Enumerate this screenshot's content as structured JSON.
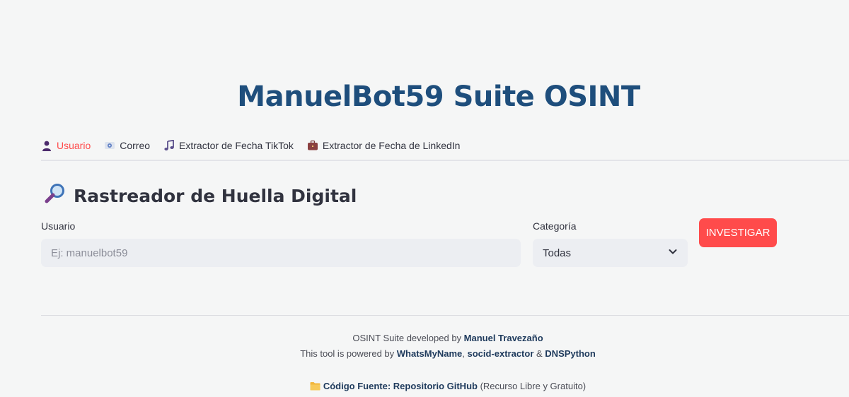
{
  "app": {
    "title": "ManuelBot59 Suite OSINT"
  },
  "tabs": [
    {
      "label": "Usuario",
      "icon": "user-icon",
      "active": true
    },
    {
      "label": "Correo",
      "icon": "email-icon",
      "active": false
    },
    {
      "label": "Extractor de Fecha TikTok",
      "icon": "music-note-icon",
      "active": false
    },
    {
      "label": "Extractor de Fecha de LinkedIn",
      "icon": "briefcase-icon",
      "active": false
    }
  ],
  "section": {
    "heading": "Rastreador de Huella Digital",
    "icon": "magnifier-icon"
  },
  "form": {
    "username_label": "Usuario",
    "username_placeholder": "Ej: manuelbot59",
    "username_value": "",
    "category_label": "Categoría",
    "category_value": "Todas",
    "submit_label": "INVESTIGAR"
  },
  "footer": {
    "line1_prefix": "OSINT Suite developed by ",
    "line1_author": "Manuel Travezaño",
    "line2_prefix": "This tool is powered by ",
    "line2_lib1": "WhatsMyName",
    "line2_sep1": ", ",
    "line2_lib2": "socid-extractor",
    "line2_sep2": " & ",
    "line2_lib3": "DNSPython",
    "line3_label": "Código Fuente:",
    "line3_link": "Repositorio GitHub",
    "line3_suffix": " (Recurso Libre y Gratuito)"
  },
  "colors": {
    "title": "#1e4e7c",
    "accent": "#ff4b4b",
    "input_bg": "#eceef2",
    "page_bg": "#f5f6f6"
  }
}
